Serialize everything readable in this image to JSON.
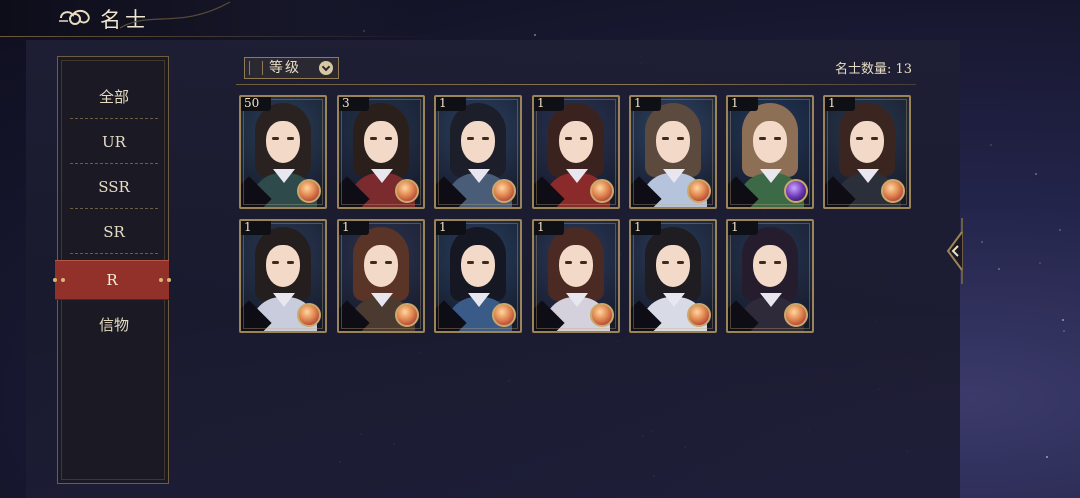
{
  "header": {
    "title": "名士",
    "icon": "scroll-cloud-icon"
  },
  "sidebar": {
    "items": [
      {
        "label": "全部",
        "active": false
      },
      {
        "label": "UR",
        "active": false
      },
      {
        "label": "SSR",
        "active": false
      },
      {
        "label": "SR",
        "active": false
      },
      {
        "label": "R",
        "active": true
      },
      {
        "label": "信物",
        "active": false
      }
    ]
  },
  "toolbar": {
    "sort_label": "等级",
    "count_text": "名士数量: 13"
  },
  "cards": [
    {
      "level": "50",
      "hair": "#2a2220",
      "robe": "#2f4a4a",
      "bg": "#29405a",
      "badge": "orange"
    },
    {
      "level": "3",
      "hair": "#2b1f1c",
      "robe": "#7b2a2e",
      "bg": "#24344e",
      "badge": "orange"
    },
    {
      "level": "1",
      "hair": "#1c1e2a",
      "robe": "#4a5d78",
      "bg": "#2c4262",
      "badge": "orange"
    },
    {
      "level": "1",
      "hair": "#3a221e",
      "robe": "#8a2a2a",
      "bg": "#2a3454",
      "badge": "orange"
    },
    {
      "level": "1",
      "hair": "#5c4a3e",
      "robe": "#b6c3dc",
      "bg": "#2f4566",
      "badge": "orange"
    },
    {
      "level": "1",
      "hair": "#8c6f54",
      "robe": "#3c6a46",
      "bg": "#22385a",
      "badge": "purple"
    },
    {
      "level": "1",
      "hair": "#3a2520",
      "robe": "#2b2f3a",
      "bg": "#28384c",
      "badge": "orange"
    },
    {
      "level": "1",
      "hair": "#251e1e",
      "robe": "#c8ccdc",
      "bg": "#2a3a56",
      "badge": "orange"
    },
    {
      "level": "1",
      "hair": "#5a3426",
      "robe": "#4a3a30",
      "bg": "#2c3450",
      "badge": "orange"
    },
    {
      "level": "1",
      "hair": "#151722",
      "robe": "#3a5a88",
      "bg": "#284060",
      "badge": "orange"
    },
    {
      "level": "1",
      "hair": "#4a2a22",
      "robe": "#d4d0dc",
      "bg": "#2c3a5a",
      "badge": "orange"
    },
    {
      "level": "1",
      "hair": "#1f1c22",
      "robe": "#d8dae6",
      "bg": "#2a3c5a",
      "badge": "orange"
    },
    {
      "level": "1",
      "hair": "#251d2e",
      "robe": "#2e2a3a",
      "bg": "#263652",
      "badge": "orange"
    }
  ],
  "colors": {
    "accent_gold": "#9a8458",
    "active_tab": "#92312a",
    "text": "#e6dcc4"
  }
}
